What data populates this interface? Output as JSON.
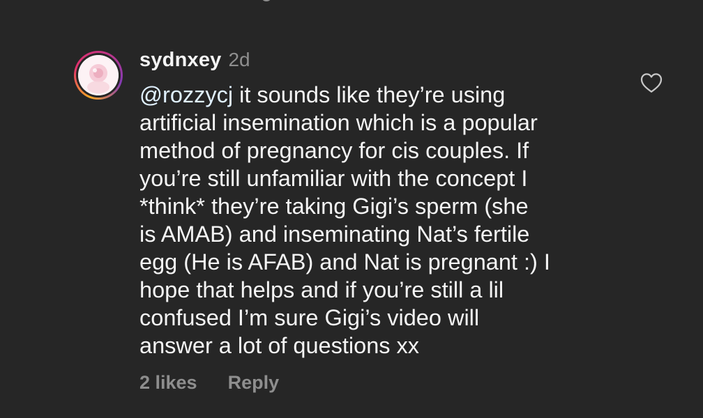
{
  "comment": {
    "username": "sydnxey",
    "timestamp": "2d",
    "mention": "@rozzycj",
    "lines": [
      " it sounds like they’re using",
      "artificial insemination which is a popular",
      "method of pregnancy for cis couples. If",
      "you’re still unfamiliar with the concept I",
      "*think* they’re taking Gigi’s sperm (she",
      "is AMAB) and inseminating Nat’s fertile",
      "egg (He is AFAB) and Nat is pregnant :) I",
      "hope that helps and if you’re still a lil",
      "confused I’m sure Gigi’s video will",
      "answer a lot of questions xx"
    ],
    "likes_label": "2 likes",
    "reply_label": "Reply"
  },
  "icons": {
    "like": "heart-outline-icon",
    "avatar": "profile-avatar"
  },
  "colors": {
    "background": "#262626",
    "text": "#f5f5f5",
    "muted": "#8e8e8e",
    "mention": "#e0f1ff"
  }
}
